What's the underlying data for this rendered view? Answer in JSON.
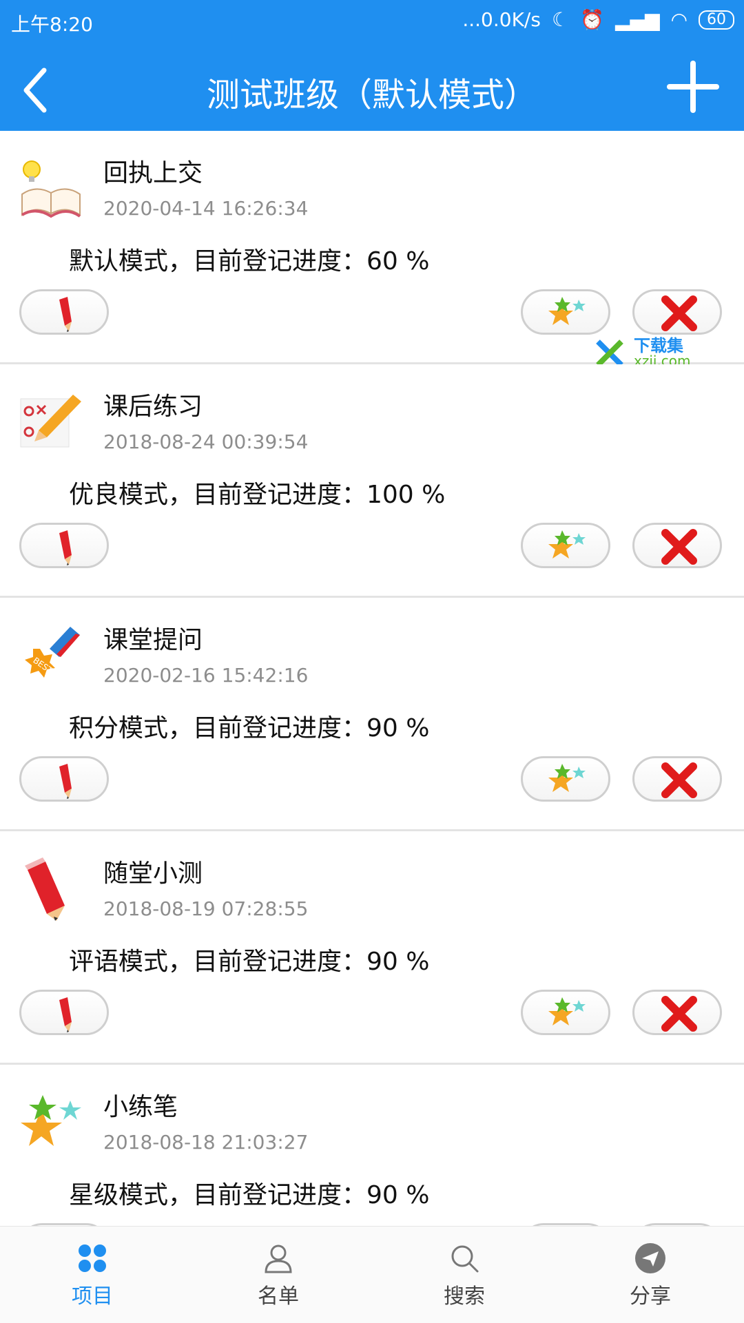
{
  "status_bar": {
    "time": "上午8:20",
    "net_speed": "...0.0K/s",
    "battery": "60"
  },
  "header": {
    "title": "测试班级（默认模式）"
  },
  "items": [
    {
      "name": "回执上交",
      "date": "2020-04-14 16:26:34",
      "status": "默认模式，目前登记进度：60 %",
      "icon": "open-book-icon"
    },
    {
      "name": "课后练习",
      "date": "2018-08-24 00:39:54",
      "status": "优良模式，目前登记进度：100 %",
      "icon": "tictactoe-pencil-icon"
    },
    {
      "name": "课堂提问",
      "date": "2020-02-16 15:42:16",
      "status": "积分模式，目前登记进度：90 %",
      "icon": "best-medal-icon"
    },
    {
      "name": "随堂小测",
      "date": "2018-08-19 07:28:55",
      "status": "评语模式，目前登记进度：90 %",
      "icon": "pencil-icon"
    },
    {
      "name": "小练笔",
      "date": "2018-08-18 21:03:27",
      "status": "星级模式，目前登记进度：90 %",
      "icon": "stars-icon"
    }
  ],
  "watermark": {
    "title": "下载集",
    "url": "xzji.com"
  },
  "bottom_nav": [
    {
      "label": "项目",
      "icon": "grid-icon",
      "active": true
    },
    {
      "label": "名单",
      "icon": "person-icon",
      "active": false
    },
    {
      "label": "搜索",
      "icon": "search-icon",
      "active": false
    },
    {
      "label": "分享",
      "icon": "share-icon",
      "active": false
    }
  ],
  "colors": {
    "primary": "#1f8ff0",
    "date_text": "#8d8d8d",
    "delete_red": "#e01b1b"
  }
}
